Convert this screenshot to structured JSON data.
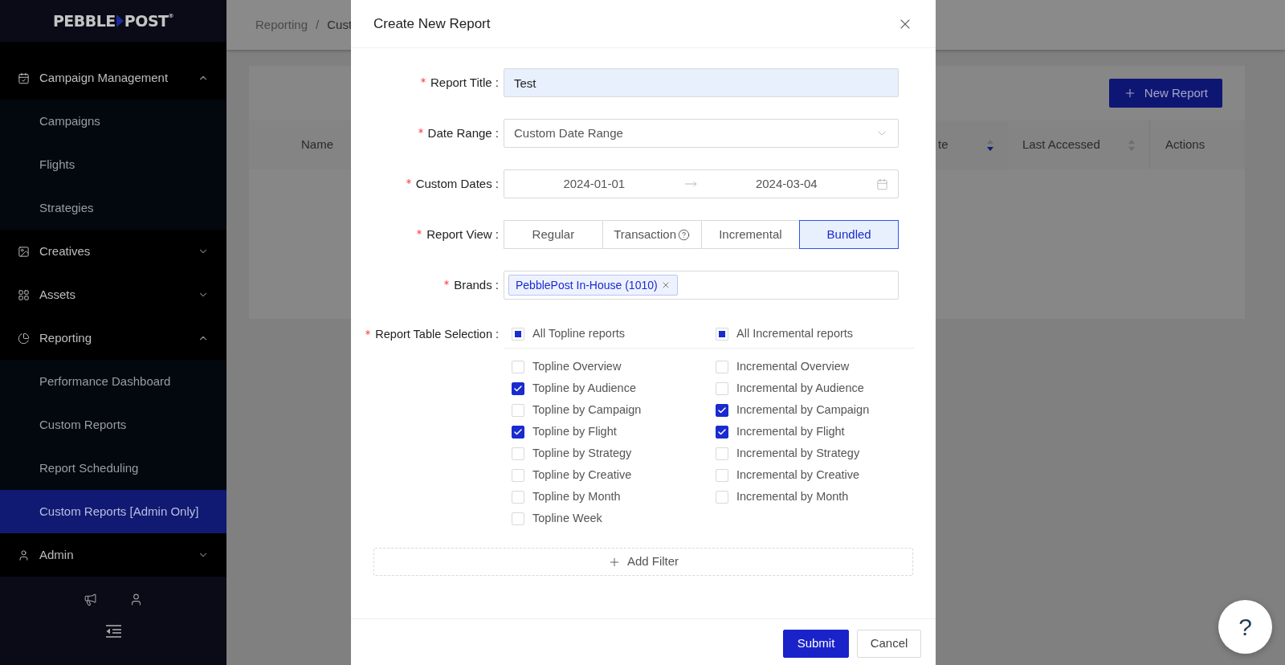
{
  "sidebar": {
    "logo": {
      "left": "PEBBLE",
      "right": "POST",
      "mark": "®"
    },
    "groups": [
      {
        "label": "Campaign Management",
        "expanded": true,
        "children": [
          {
            "label": "Campaigns",
            "selected": false
          },
          {
            "label": "Flights",
            "selected": false
          },
          {
            "label": "Strategies",
            "selected": false
          }
        ]
      },
      {
        "label": "Creatives",
        "expanded": false
      },
      {
        "label": "Assets",
        "expanded": false
      },
      {
        "label": "Reporting",
        "expanded": true,
        "children": [
          {
            "label": "Performance Dashboard",
            "selected": false
          },
          {
            "label": "Custom Reports",
            "selected": false
          },
          {
            "label": "Report Scheduling",
            "selected": false
          },
          {
            "label": "Custom Reports [Admin Only]",
            "selected": true
          }
        ]
      },
      {
        "label": "Admin",
        "expanded": false
      }
    ]
  },
  "breadcrumb": [
    "Reporting",
    "/",
    "Cust"
  ],
  "toolbar": {
    "new_report_button": "New Report"
  },
  "table": {
    "columns": [
      {
        "label": "Name",
        "sortable": false
      },
      {
        "label": "te",
        "sortable": true,
        "sorted_descending": true
      },
      {
        "label": "Last Accessed",
        "sortable": true,
        "sorted_descending": false
      },
      {
        "label": "Actions",
        "sortable": false
      }
    ]
  },
  "modal": {
    "title": "Create New Report",
    "fields": [
      {
        "kind": "text",
        "label": "Report Title :",
        "required": true,
        "value": "Test"
      },
      {
        "kind": "select",
        "label": "Date Range :",
        "required": true,
        "value": "Custom Date Range"
      },
      {
        "kind": "date_range",
        "label": "Custom Dates :",
        "required": true,
        "start": "2024-01-01",
        "end": "2024-03-04"
      },
      {
        "kind": "segmented",
        "label": "Report View :",
        "required": true,
        "options": [
          {
            "label": "Regular",
            "selected": false,
            "help": false
          },
          {
            "label": "Transaction",
            "selected": false,
            "help": true
          },
          {
            "label": "Incremental",
            "selected": false,
            "help": false
          },
          {
            "label": "Bundled",
            "selected": true,
            "help": false
          }
        ]
      },
      {
        "kind": "tags",
        "label": "Brands :",
        "required": true,
        "tags": [
          "PebblePost In-House (1010)"
        ]
      }
    ],
    "table_selection": {
      "label": "Report Table Selection :",
      "required": true,
      "columns": [
        {
          "all": {
            "label": "All Topline reports",
            "indeterminate": true
          },
          "items": [
            {
              "label": "Topline Overview",
              "checked": false
            },
            {
              "label": "Topline by Audience",
              "checked": true
            },
            {
              "label": "Topline by Campaign",
              "checked": false
            },
            {
              "label": "Topline by Flight",
              "checked": true
            },
            {
              "label": "Topline by Strategy",
              "checked": false
            },
            {
              "label": "Topline by Creative",
              "checked": false
            },
            {
              "label": "Topline by Month",
              "checked": false
            },
            {
              "label": "Topline Week",
              "checked": false
            }
          ]
        },
        {
          "all": {
            "label": "All Incremental reports",
            "indeterminate": true
          },
          "items": [
            {
              "label": "Incremental Overview",
              "checked": false
            },
            {
              "label": "Incremental by Audience",
              "checked": false
            },
            {
              "label": "Incremental by Campaign",
              "checked": true
            },
            {
              "label": "Incremental by Flight",
              "checked": true
            },
            {
              "label": "Incremental by Strategy",
              "checked": false
            },
            {
              "label": "Incremental by Creative",
              "checked": false
            },
            {
              "label": "Incremental by Month",
              "checked": false
            }
          ]
        }
      ]
    },
    "add_filter_button": "Add Filter",
    "buttons": [
      {
        "label": "Submit",
        "kind": "primary"
      },
      {
        "label": "Cancel",
        "kind": "default"
      }
    ]
  },
  "help_button": "?"
}
